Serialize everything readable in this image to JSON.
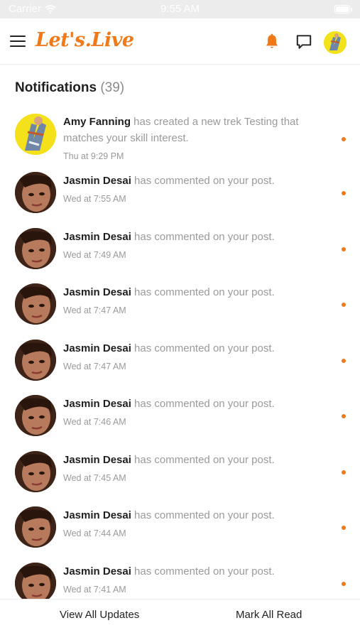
{
  "status_bar": {
    "carrier": "Carrier",
    "time": "9:55 AM"
  },
  "header": {
    "logo": "Let's.Live",
    "icons": {
      "menu": "hamburger-menu-icon",
      "bell": "bell-icon",
      "chat": "chat-bubble-icon"
    },
    "accent_color": "#f07a1a"
  },
  "notifications": {
    "title": "Notifications",
    "count": "(39)",
    "items": [
      {
        "name": "Amy Fanning",
        "message": " has created a new trek Testing that matches your skill interest.",
        "time": "Thu at 9:29 PM",
        "avatar": "amy",
        "unread": true
      },
      {
        "name": "Jasmin Desai",
        "message": " has commented on your post.",
        "time": "Wed at 7:55 AM",
        "avatar": "jasmin",
        "unread": true
      },
      {
        "name": "Jasmin Desai",
        "message": " has commented on your post.",
        "time": "Wed at 7:49 AM",
        "avatar": "jasmin",
        "unread": true
      },
      {
        "name": "Jasmin Desai",
        "message": " has commented on your post.",
        "time": "Wed at 7:47 AM",
        "avatar": "jasmin",
        "unread": true
      },
      {
        "name": "Jasmin Desai",
        "message": " has commented on your post.",
        "time": "Wed at 7:47 AM",
        "avatar": "jasmin",
        "unread": true
      },
      {
        "name": "Jasmin Desai",
        "message": " has commented on your post.",
        "time": "Wed at 7:46 AM",
        "avatar": "jasmin",
        "unread": true
      },
      {
        "name": "Jasmin Desai",
        "message": " has commented on your post.",
        "time": "Wed at 7:45 AM",
        "avatar": "jasmin",
        "unread": true
      },
      {
        "name": "Jasmin Desai",
        "message": " has commented on your post.",
        "time": "Wed at 7:44 AM",
        "avatar": "jasmin",
        "unread": true
      },
      {
        "name": "Jasmin Desai",
        "message": " has commented on your post.",
        "time": "Wed at 7:41 AM",
        "avatar": "jasmin",
        "unread": true
      }
    ]
  },
  "footer": {
    "view_all": "View All Updates",
    "mark_all": "Mark All Read"
  }
}
